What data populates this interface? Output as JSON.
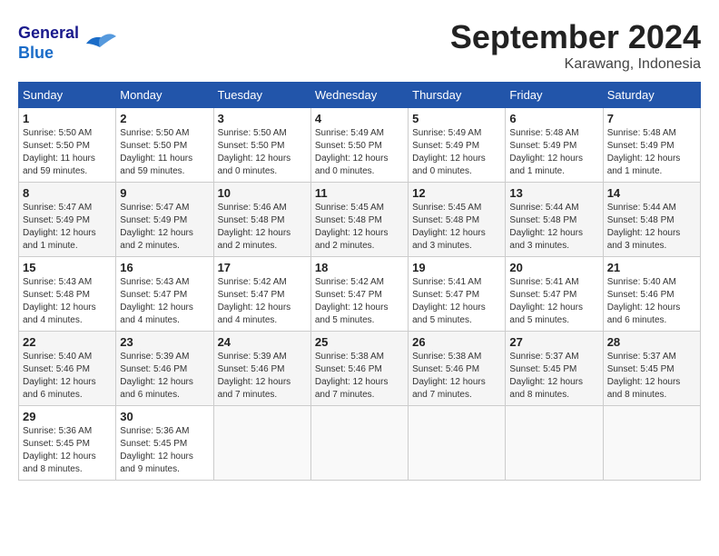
{
  "header": {
    "logo_line1": "General",
    "logo_line2": "Blue",
    "month_title": "September 2024",
    "location": "Karawang, Indonesia"
  },
  "calendar": {
    "headers": [
      "Sunday",
      "Monday",
      "Tuesday",
      "Wednesday",
      "Thursday",
      "Friday",
      "Saturday"
    ],
    "weeks": [
      [
        {
          "day": "",
          "info": ""
        },
        {
          "day": "2",
          "info": "Sunrise: 5:50 AM\nSunset: 5:50 PM\nDaylight: 11 hours\nand 59 minutes."
        },
        {
          "day": "3",
          "info": "Sunrise: 5:50 AM\nSunset: 5:50 PM\nDaylight: 12 hours\nand 0 minutes."
        },
        {
          "day": "4",
          "info": "Sunrise: 5:49 AM\nSunset: 5:50 PM\nDaylight: 12 hours\nand 0 minutes."
        },
        {
          "day": "5",
          "info": "Sunrise: 5:49 AM\nSunset: 5:49 PM\nDaylight: 12 hours\nand 0 minutes."
        },
        {
          "day": "6",
          "info": "Sunrise: 5:48 AM\nSunset: 5:49 PM\nDaylight: 12 hours\nand 1 minute."
        },
        {
          "day": "7",
          "info": "Sunrise: 5:48 AM\nSunset: 5:49 PM\nDaylight: 12 hours\nand 1 minute."
        }
      ],
      [
        {
          "day": "8",
          "info": "Sunrise: 5:47 AM\nSunset: 5:49 PM\nDaylight: 12 hours\nand 1 minute."
        },
        {
          "day": "9",
          "info": "Sunrise: 5:47 AM\nSunset: 5:49 PM\nDaylight: 12 hours\nand 2 minutes."
        },
        {
          "day": "10",
          "info": "Sunrise: 5:46 AM\nSunset: 5:48 PM\nDaylight: 12 hours\nand 2 minutes."
        },
        {
          "day": "11",
          "info": "Sunrise: 5:45 AM\nSunset: 5:48 PM\nDaylight: 12 hours\nand 2 minutes."
        },
        {
          "day": "12",
          "info": "Sunrise: 5:45 AM\nSunset: 5:48 PM\nDaylight: 12 hours\nand 3 minutes."
        },
        {
          "day": "13",
          "info": "Sunrise: 5:44 AM\nSunset: 5:48 PM\nDaylight: 12 hours\nand 3 minutes."
        },
        {
          "day": "14",
          "info": "Sunrise: 5:44 AM\nSunset: 5:48 PM\nDaylight: 12 hours\nand 3 minutes."
        }
      ],
      [
        {
          "day": "15",
          "info": "Sunrise: 5:43 AM\nSunset: 5:48 PM\nDaylight: 12 hours\nand 4 minutes."
        },
        {
          "day": "16",
          "info": "Sunrise: 5:43 AM\nSunset: 5:47 PM\nDaylight: 12 hours\nand 4 minutes."
        },
        {
          "day": "17",
          "info": "Sunrise: 5:42 AM\nSunset: 5:47 PM\nDaylight: 12 hours\nand 4 minutes."
        },
        {
          "day": "18",
          "info": "Sunrise: 5:42 AM\nSunset: 5:47 PM\nDaylight: 12 hours\nand 5 minutes."
        },
        {
          "day": "19",
          "info": "Sunrise: 5:41 AM\nSunset: 5:47 PM\nDaylight: 12 hours\nand 5 minutes."
        },
        {
          "day": "20",
          "info": "Sunrise: 5:41 AM\nSunset: 5:47 PM\nDaylight: 12 hours\nand 5 minutes."
        },
        {
          "day": "21",
          "info": "Sunrise: 5:40 AM\nSunset: 5:46 PM\nDaylight: 12 hours\nand 6 minutes."
        }
      ],
      [
        {
          "day": "22",
          "info": "Sunrise: 5:40 AM\nSunset: 5:46 PM\nDaylight: 12 hours\nand 6 minutes."
        },
        {
          "day": "23",
          "info": "Sunrise: 5:39 AM\nSunset: 5:46 PM\nDaylight: 12 hours\nand 6 minutes."
        },
        {
          "day": "24",
          "info": "Sunrise: 5:39 AM\nSunset: 5:46 PM\nDaylight: 12 hours\nand 7 minutes."
        },
        {
          "day": "25",
          "info": "Sunrise: 5:38 AM\nSunset: 5:46 PM\nDaylight: 12 hours\nand 7 minutes."
        },
        {
          "day": "26",
          "info": "Sunrise: 5:38 AM\nSunset: 5:46 PM\nDaylight: 12 hours\nand 7 minutes."
        },
        {
          "day": "27",
          "info": "Sunrise: 5:37 AM\nSunset: 5:45 PM\nDaylight: 12 hours\nand 8 minutes."
        },
        {
          "day": "28",
          "info": "Sunrise: 5:37 AM\nSunset: 5:45 PM\nDaylight: 12 hours\nand 8 minutes."
        }
      ],
      [
        {
          "day": "29",
          "info": "Sunrise: 5:36 AM\nSunset: 5:45 PM\nDaylight: 12 hours\nand 8 minutes."
        },
        {
          "day": "30",
          "info": "Sunrise: 5:36 AM\nSunset: 5:45 PM\nDaylight: 12 hours\nand 9 minutes."
        },
        {
          "day": "",
          "info": ""
        },
        {
          "day": "",
          "info": ""
        },
        {
          "day": "",
          "info": ""
        },
        {
          "day": "",
          "info": ""
        },
        {
          "day": "",
          "info": ""
        }
      ]
    ],
    "week1_sunday": {
      "day": "1",
      "info": "Sunrise: 5:50 AM\nSunset: 5:50 PM\nDaylight: 11 hours\nand 59 minutes."
    }
  }
}
